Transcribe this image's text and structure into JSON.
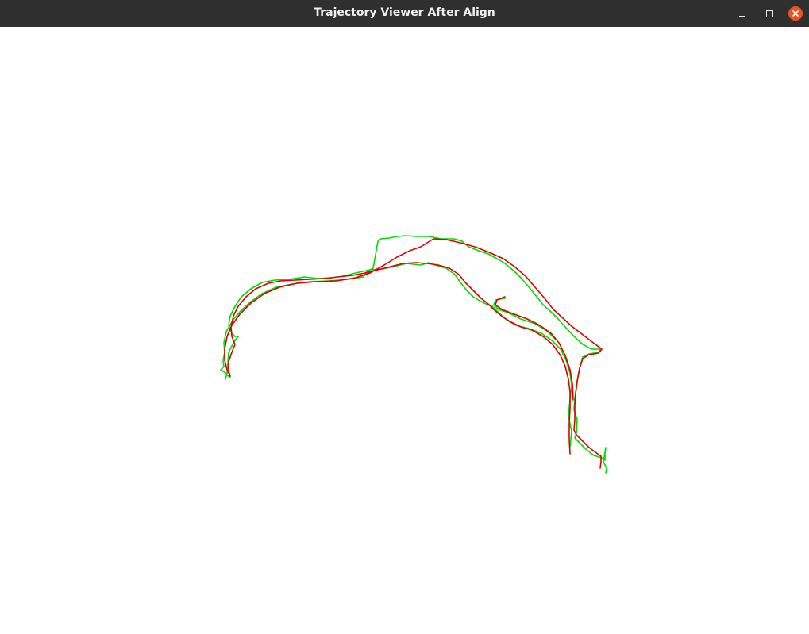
{
  "window": {
    "title": "Trajectory Viewer After Align",
    "controls": [
      "minimize",
      "maximize",
      "close"
    ]
  },
  "viewer": {
    "background": "#ffffff",
    "trajectories": [
      {
        "role": "ground-truth",
        "color": "#00dd00"
      },
      {
        "role": "aligned-estimate",
        "color": "#dd0000"
      }
    ]
  },
  "colors": {
    "titlebar": "#2f2f2f",
    "close_button": "#e95420"
  }
}
